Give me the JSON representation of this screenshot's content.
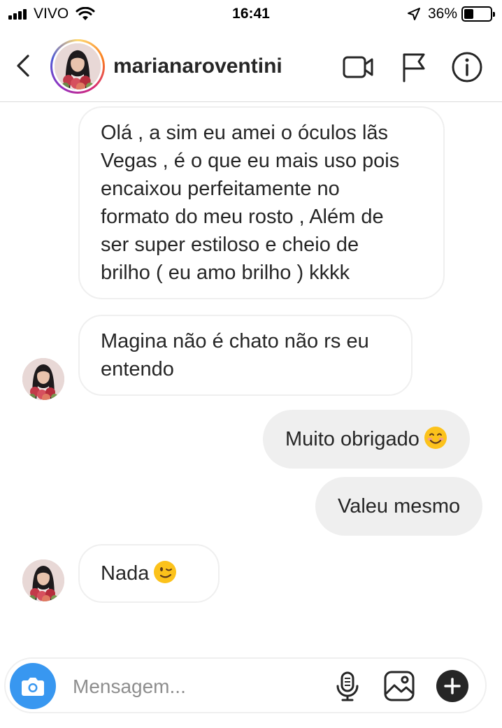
{
  "status_bar": {
    "carrier": "VIVO",
    "time": "16:41",
    "battery_percent": "36%",
    "battery_level": 0.36
  },
  "header": {
    "username": "marianaroventini",
    "icons": [
      "back-chevron-icon",
      "video-call-icon",
      "flag-icon",
      "info-icon"
    ]
  },
  "messages": [
    {
      "direction": "received",
      "lines": [
        "Olá , a sim eu amei o óculos lãs",
        "Vegas , é o que eu mais uso pois",
        "encaixou perfeitamente no",
        "formato do meu rosto , Além de",
        "ser super estiloso e cheio de",
        "brilho ( eu amo brilho ) kkkk"
      ]
    },
    {
      "direction": "received",
      "lines": [
        "Magina não é chato não rs eu",
        "entendo"
      ]
    },
    {
      "direction": "sent",
      "text": "Muito obrigado",
      "emoji": "smiling-face-emoji"
    },
    {
      "direction": "sent",
      "text": "Valeu mesmo"
    },
    {
      "direction": "received",
      "text": "Nada",
      "emoji": "winking-face-emoji"
    }
  ],
  "composer": {
    "placeholder": "Mensagem...",
    "icons": [
      "camera-icon",
      "microphone-icon",
      "gallery-icon",
      "add-icon"
    ]
  },
  "colors": {
    "accent_blue": "#3897f0",
    "sent_bubble": "#efefef",
    "text": "#262626",
    "placeholder": "#8e8e8e"
  }
}
